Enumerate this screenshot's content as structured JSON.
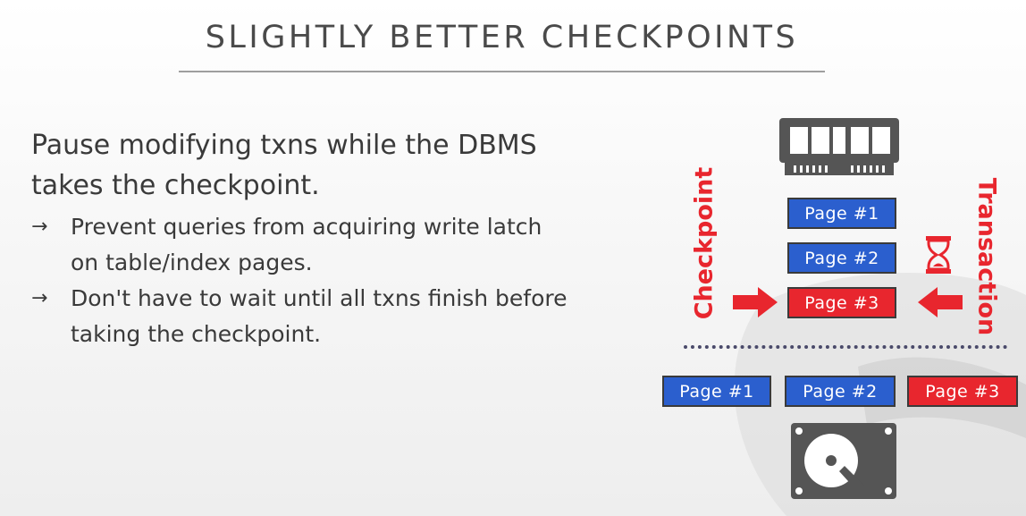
{
  "slide": {
    "title": "SLIGHTLY BETTER CHECKPOINTS",
    "lead": "Pause modifying txns while the DBMS takes the checkpoint.",
    "bullets": [
      "Prevent queries from acquiring write latch on table/index pages.",
      "Don't have to wait until all txns finish before taking the checkpoint."
    ],
    "arrow_glyph": "→"
  },
  "diagram": {
    "checkpoint_label": "Checkpoint",
    "transaction_label": "Transaction",
    "memory_pages": [
      {
        "label": "Page  #1",
        "state": "clean"
      },
      {
        "label": "Page  #2",
        "state": "clean"
      },
      {
        "label": "Page  #3",
        "state": "dirty"
      }
    ],
    "disk_pages": [
      {
        "label": "Page  #1",
        "state": "clean"
      },
      {
        "label": "Page  #2",
        "state": "clean"
      },
      {
        "label": "Page  #3",
        "state": "dirty"
      }
    ],
    "icons": {
      "memory": "ram-chip-icon",
      "disk": "hard-disk-icon",
      "wait": "hourglass-icon",
      "arrows": "right-arrow-icon, left-arrow-icon"
    },
    "colors": {
      "clean": "#2b5fce",
      "dirty": "#e8262e",
      "label": "#e8262e"
    }
  }
}
